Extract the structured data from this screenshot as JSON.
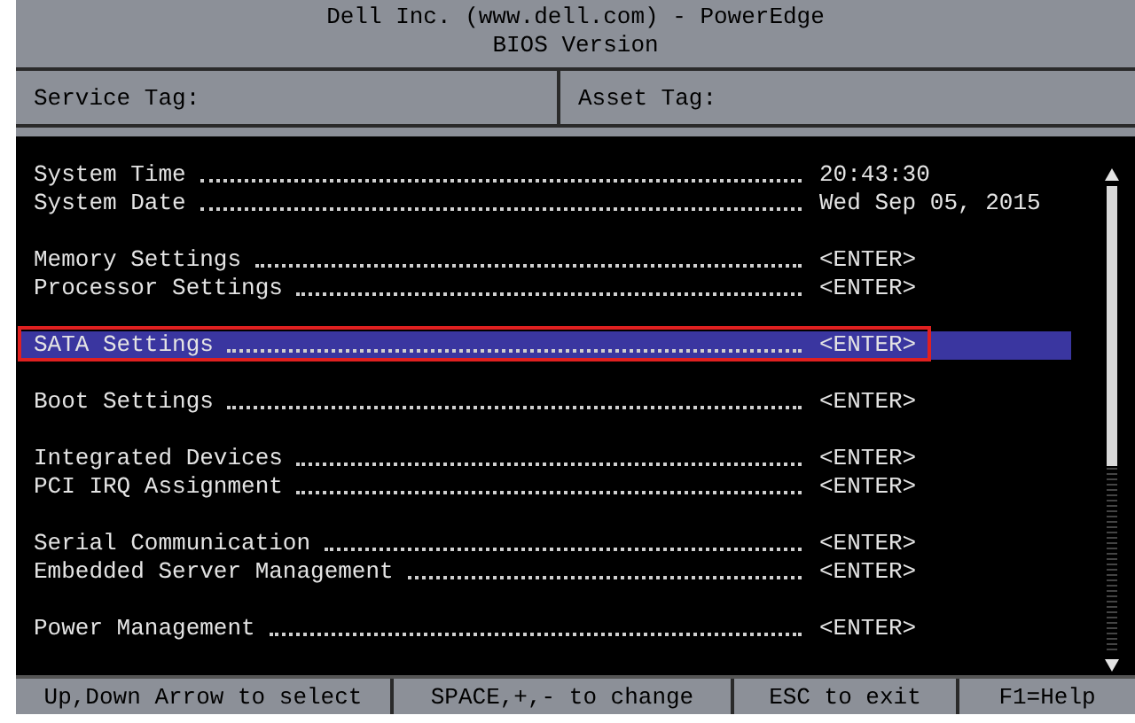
{
  "header": {
    "title": "Dell Inc. (www.dell.com) - PowerEdge",
    "subtitle": "BIOS Version"
  },
  "tags": [
    {
      "label": "Service Tag:"
    },
    {
      "label": "Asset Tag:"
    }
  ],
  "menu_groups": [
    {
      "items": [
        {
          "label": "System Time",
          "value": "20:43:30",
          "selected": false,
          "outlined": false
        },
        {
          "label": "System Date",
          "value": "Wed Sep 05, 2015",
          "selected": false,
          "outlined": false
        }
      ]
    },
    {
      "items": [
        {
          "label": "Memory Settings",
          "value": "<ENTER>",
          "selected": false,
          "outlined": false
        },
        {
          "label": "Processor Settings",
          "value": "<ENTER>",
          "selected": false,
          "outlined": false
        }
      ]
    },
    {
      "items": [
        {
          "label": "SATA Settings",
          "value": "<ENTER>",
          "selected": true,
          "outlined": true
        }
      ]
    },
    {
      "items": [
        {
          "label": "Boot Settings",
          "value": "<ENTER>",
          "selected": false,
          "outlined": false
        }
      ]
    },
    {
      "items": [
        {
          "label": "Integrated Devices",
          "value": "<ENTER>",
          "selected": false,
          "outlined": false
        },
        {
          "label": "PCI IRQ Assignment",
          "value": "<ENTER>",
          "selected": false,
          "outlined": false
        }
      ]
    },
    {
      "items": [
        {
          "label": "Serial Communication",
          "value": "<ENTER>",
          "selected": false,
          "outlined": false
        },
        {
          "label": "Embedded Server Management",
          "value": "<ENTER>",
          "selected": false,
          "outlined": false
        }
      ]
    },
    {
      "items": [
        {
          "label": "Power Management",
          "value": "<ENTER>",
          "selected": false,
          "outlined": false
        }
      ]
    }
  ],
  "status_bar": [
    "Up,Down Arrow to select",
    "SPACE,+,- to change",
    "ESC to exit",
    "F1=Help"
  ]
}
